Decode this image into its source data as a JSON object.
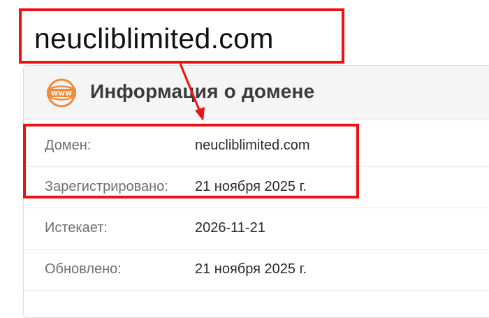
{
  "callout": {
    "text": "neucliblimited.com"
  },
  "card": {
    "title": "Информация о домене",
    "icon": "www-globe-icon",
    "rows": [
      {
        "label": "Домен:",
        "value": "neucliblimited.com"
      },
      {
        "label": "Зарегистрировано:",
        "value": "21 ноября 2025 г."
      },
      {
        "label": "Истекает:",
        "value": "2026-11-21"
      },
      {
        "label": "Обновлено:",
        "value": "21 ноября 2025 г."
      }
    ]
  },
  "colors": {
    "highlight": "#ee1111",
    "icon_accent": "#f08c3a",
    "header_bg": "#f5f5f5"
  }
}
